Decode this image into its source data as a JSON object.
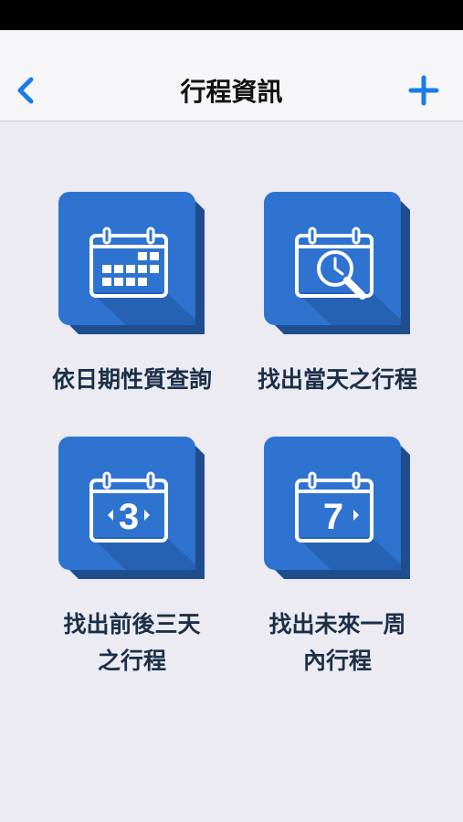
{
  "header": {
    "title": "行程資訊"
  },
  "colors": {
    "tile_face": "#2f73d1",
    "tile_shadow": "#1f4e8f",
    "label_text": "#1c2f49",
    "nav_accent": "#1a7ce8"
  },
  "tiles": [
    {
      "icon": "calendar-grid-icon",
      "label_lines": [
        "依日期性質查詢"
      ]
    },
    {
      "icon": "calendar-clock-search-icon",
      "label_lines": [
        "找出當天之行程"
      ]
    },
    {
      "icon": "calendar-3-icon",
      "icon_text": "3",
      "label_lines": [
        "找出前後三天",
        "之行程"
      ]
    },
    {
      "icon": "calendar-7-icon",
      "icon_text": "7",
      "label_lines": [
        "找出未來一周",
        "內行程"
      ]
    }
  ]
}
